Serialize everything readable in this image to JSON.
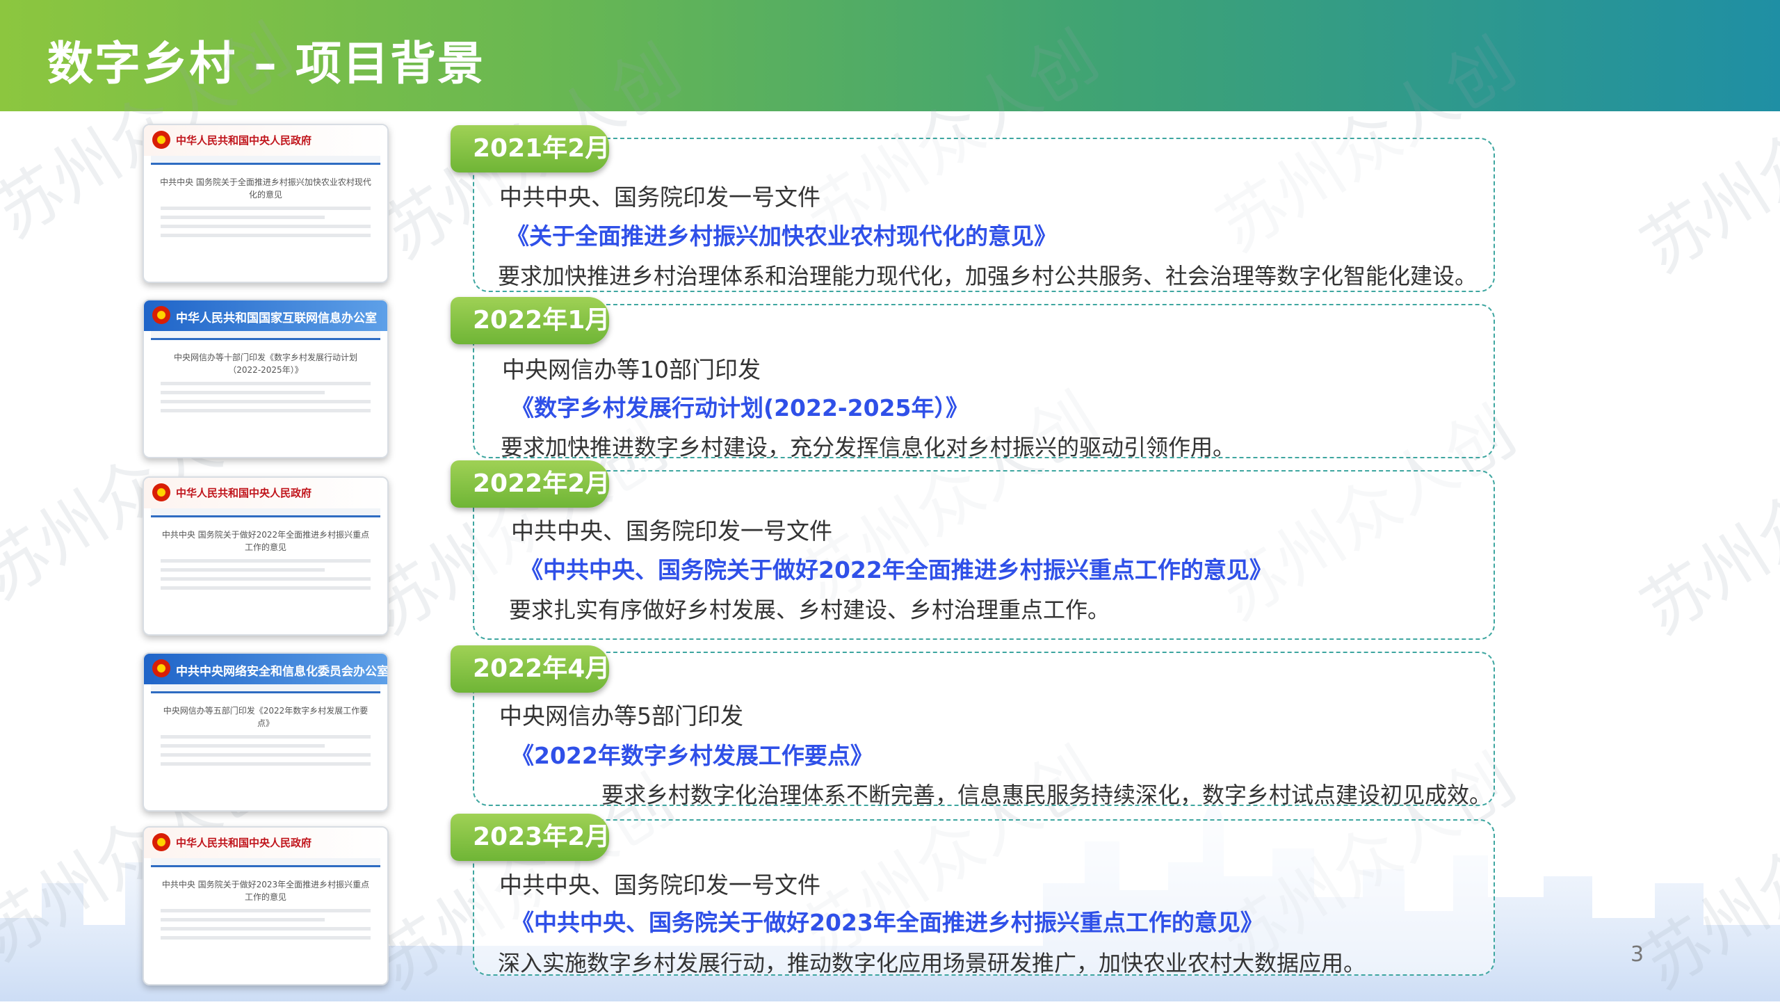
{
  "title": "数字乡村 – 项目背景",
  "watermark": "苏州众人创",
  "thumbnails": [
    {
      "header": "中华人民共和国中央人民政府",
      "style": "red",
      "doc_title": "中共中央 国务院关于全面推进乡村振兴加快农业农村现代化的意见"
    },
    {
      "header": "中华人民共和国国家互联网信息办公室",
      "style": "blue",
      "doc_title": "中央网信办等十部门印发《数字乡村发展行动计划（2022-2025年）》"
    },
    {
      "header": "中华人民共和国中央人民政府",
      "style": "red",
      "doc_title": "中共中央 国务院关于做好2022年全面推进乡村振兴重点工作的意见"
    },
    {
      "header": "中共中央网络安全和信息化委员会办公室",
      "style": "blue",
      "doc_title": "中央网信办等五部门印发《2022年数字乡村发展工作要点》"
    },
    {
      "header": "中华人民共和国中央人民政府",
      "style": "red",
      "doc_title": "中共中央 国务院关于做好2023年全面推进乡村振兴重点工作的意见"
    }
  ],
  "entries": [
    {
      "date": "2021年2月",
      "issuer": "中共中央、国务院印发一号文件",
      "document": "《关于全面推进乡村振兴加快农业农村现代化的意见》",
      "requirement": "要求加快推进乡村治理体系和治理能力现代化，加强乡村公共服务、社会治理等数字化智能化建设。"
    },
    {
      "date": "2022年1月",
      "issuer": "中央网信办等10部门印发",
      "document": "《数字乡村发展行动计划(2022-2025年）》",
      "requirement": "要求加快推进数字乡村建设，充分发挥信息化对乡村振兴的驱动引领作用。"
    },
    {
      "date": "2022年2月",
      "issuer": "中共中央、国务院印发一号文件",
      "document": "《中共中央、国务院关于做好2022年全面推进乡村振兴重点工作的意见》",
      "requirement": "要求扎实有序做好乡村发展、乡村建设、乡村治理重点工作。"
    },
    {
      "date": "2022年4月",
      "issuer": "中央网信办等5部门印发",
      "document": "《2022年数字乡村发展工作要点》",
      "requirement": "要求乡村数字化治理体系不断完善，信息惠民服务持续深化，数字乡村试点建设初见成效。"
    },
    {
      "date": "2023年2月",
      "issuer": "中共中央、国务院印发一号文件",
      "document": "《中共中央、国务院关于做好2023年全面推进乡村振兴重点工作的意见》",
      "requirement": "深入实施数字乡村发展行动，推动数字化应用场景研发推广，加快农业农村大数据应用。"
    }
  ],
  "page_number": "3"
}
